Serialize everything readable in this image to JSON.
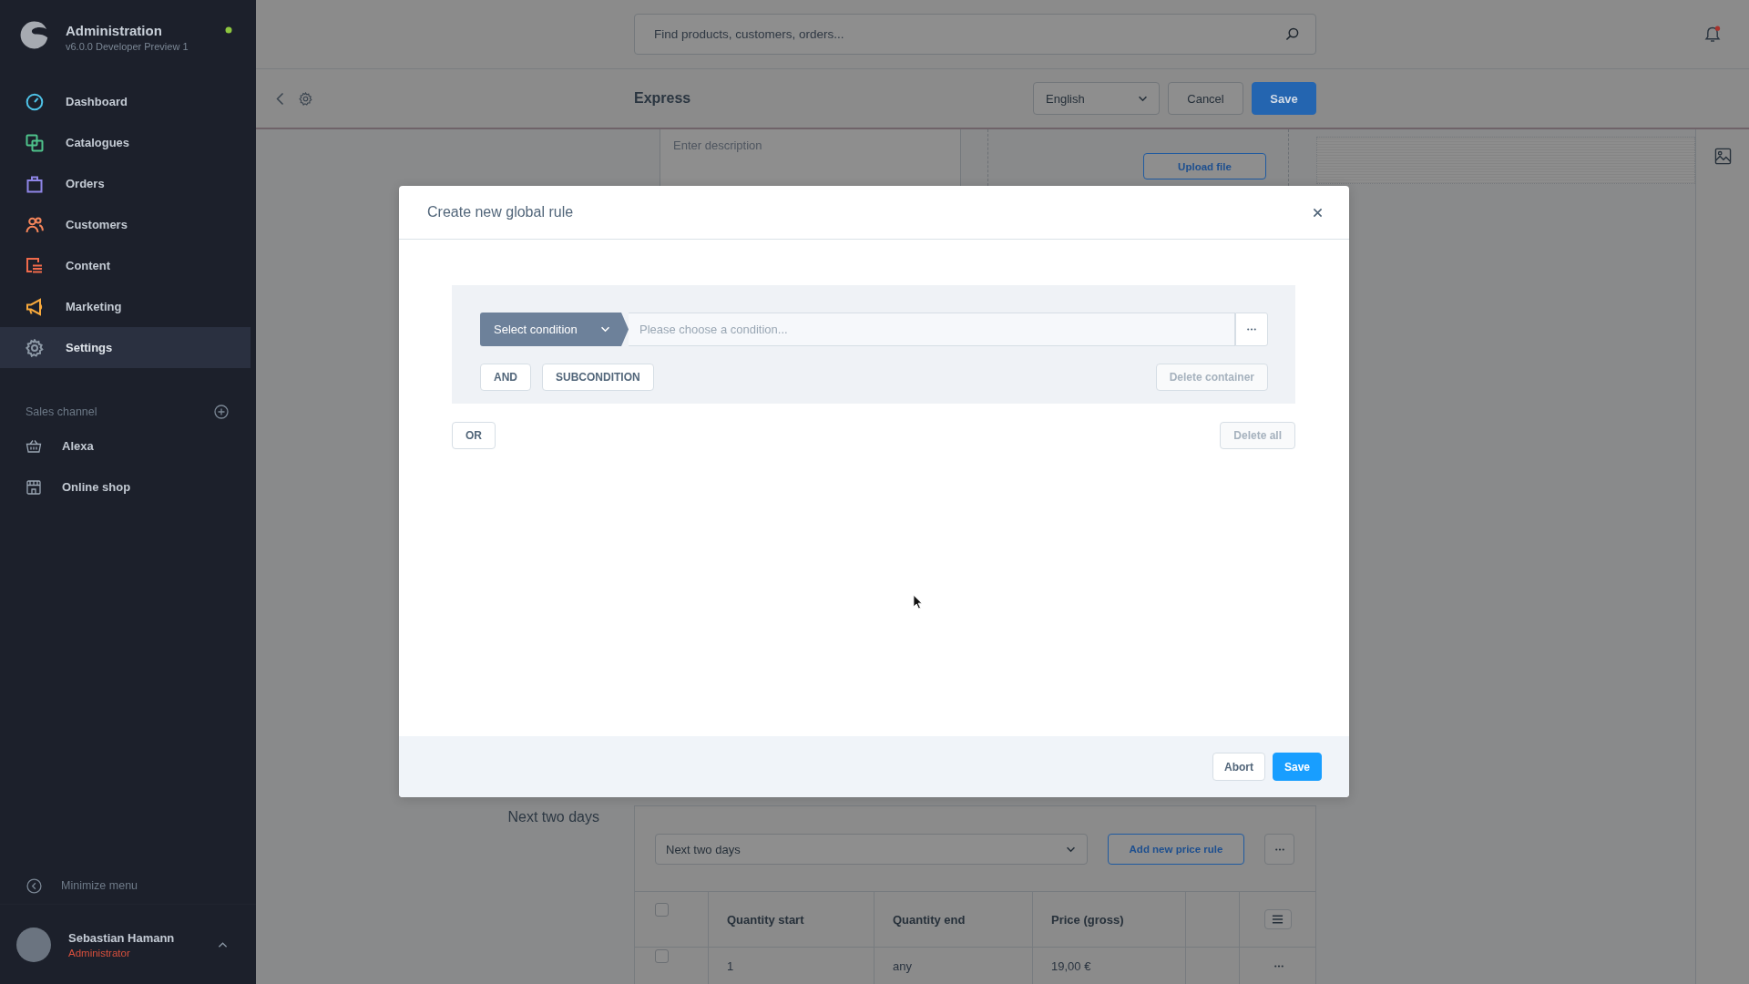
{
  "sidebar": {
    "title": "Administration",
    "version": "v6.0.0 Developer Preview 1",
    "nav_items": [
      {
        "label": "Dashboard",
        "color": "#4fc3e8",
        "selected": false
      },
      {
        "label": "Catalogues",
        "color": "#4fc38c",
        "selected": false
      },
      {
        "label": "Orders",
        "color": "#8f86e8",
        "selected": false
      },
      {
        "label": "Customers",
        "color": "#f5855a",
        "selected": false
      },
      {
        "label": "Content",
        "color": "#f06a4b",
        "selected": false
      },
      {
        "label": "Marketing",
        "color": "#f8a93c",
        "selected": false
      },
      {
        "label": "Settings",
        "color": "#8d99a6",
        "selected": true
      }
    ],
    "sales_channel": {
      "title": "Sales channel",
      "items": [
        {
          "label": "Alexa",
          "selected": false
        },
        {
          "label": "Online shop",
          "selected": false
        }
      ]
    },
    "minimize": "Minimize menu",
    "user": {
      "name": "Sebastian Hamann",
      "role": "Administrator"
    }
  },
  "top_bar": {
    "search": {
      "placeholder": "Find products, customers, orders..."
    }
  },
  "smart_bar": {
    "title": "Express",
    "language": "English",
    "buttons": [
      {
        "label": "Cancel",
        "kind": "secondary"
      },
      {
        "label": "Save",
        "kind": "primary"
      }
    ]
  },
  "detail": {
    "description": {
      "placeholder": "Enter description"
    },
    "upload_button": "Upload file"
  },
  "price_section": {
    "label": "Next two days",
    "rule_select": "Next two days",
    "add_button": "Add new price rule",
    "table": {
      "header_checked": false,
      "columns": [
        "Quantity start",
        "Quantity end",
        "Price (gross)"
      ],
      "rows": [
        {
          "checked": false,
          "cells": [
            "1",
            "any",
            "19,00 €"
          ]
        }
      ]
    }
  },
  "modal": {
    "title": "Create new global rule",
    "condition": {
      "select": "Select condition",
      "placeholder": "Please choose a condition..."
    },
    "container_buttons": [
      {
        "label": "AND",
        "disabled": false
      },
      {
        "label": "SUBCONDITION",
        "disabled": false
      }
    ],
    "delete_container": {
      "label": "Delete container",
      "disabled": true
    },
    "or_button": {
      "label": "OR",
      "disabled": false
    },
    "delete_all": {
      "label": "Delete all",
      "disabled": true
    },
    "footer_buttons": [
      {
        "label": "Abort",
        "kind": "secondary"
      },
      {
        "label": "Save",
        "kind": "primary"
      }
    ]
  }
}
